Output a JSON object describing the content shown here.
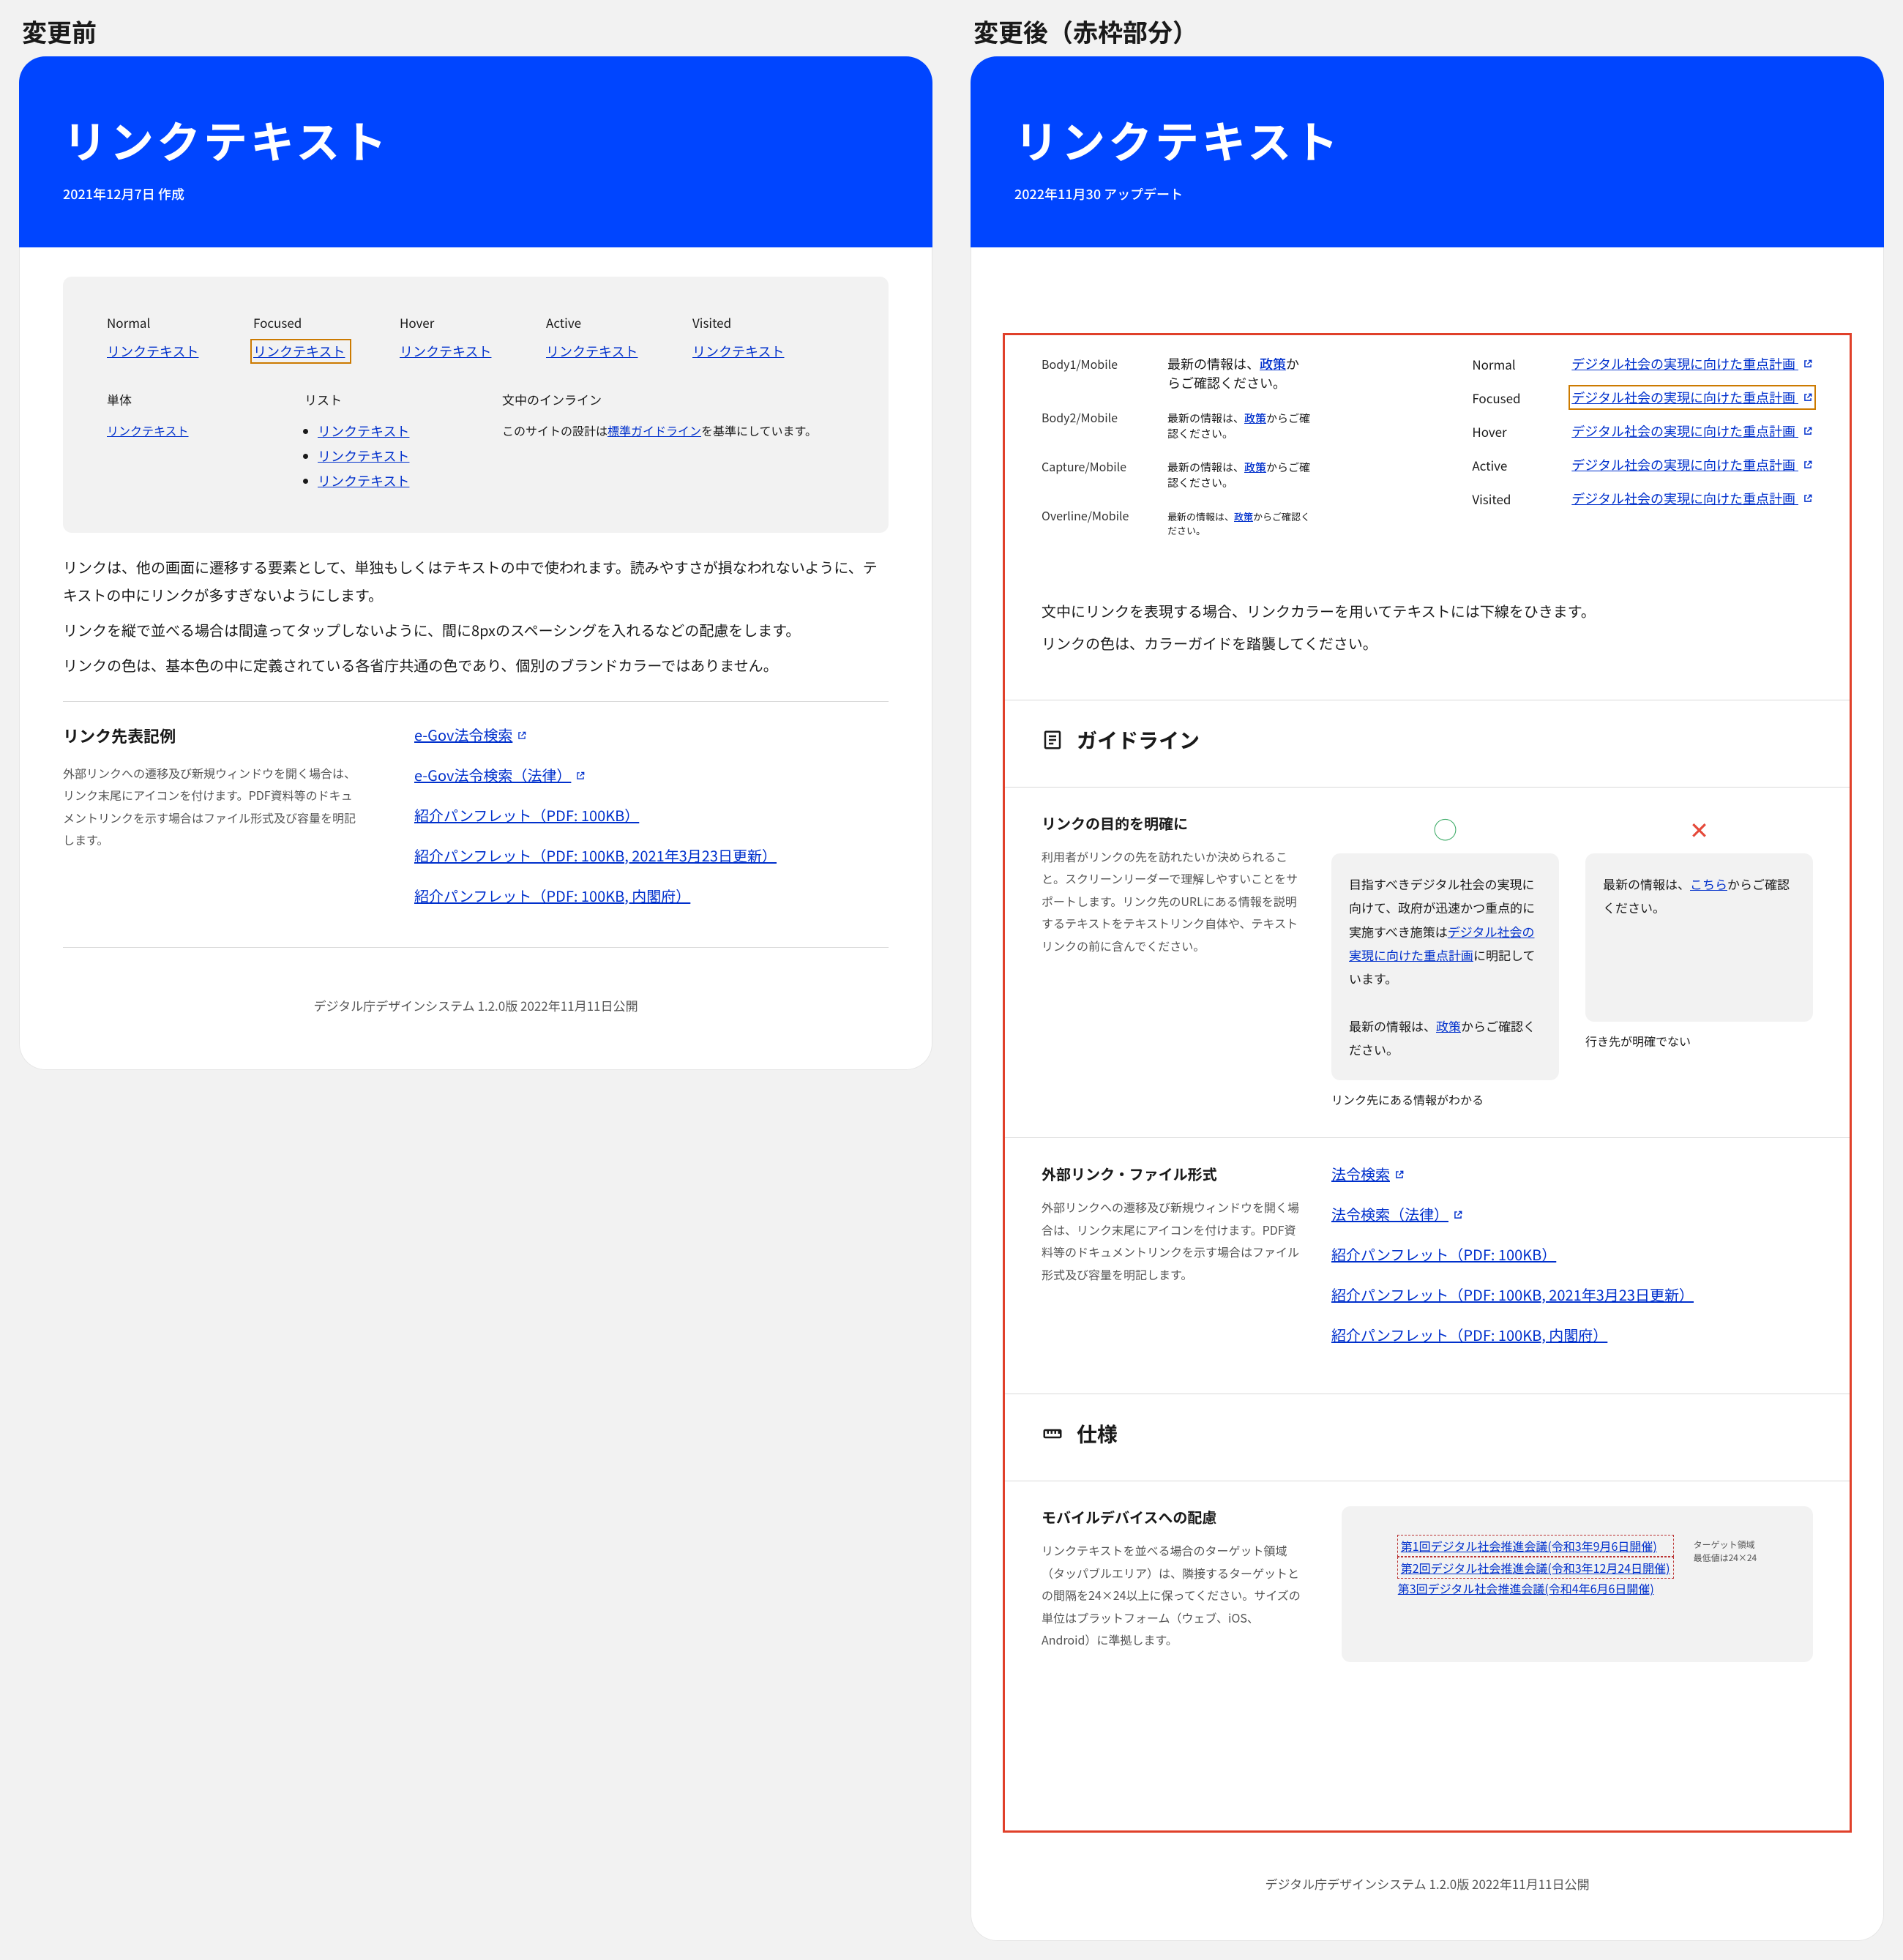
{
  "labels": {
    "before": "変更前",
    "after": "変更後（赤枠部分）"
  },
  "header": {
    "title": "リンクテキスト",
    "date_before": "2021年12月7日 作成",
    "date_after": "2022年11月30 アップデート"
  },
  "left": {
    "state_labels": {
      "normal": "Normal",
      "focused": "Focused",
      "hover": "Hover",
      "active": "Active",
      "visited": "Visited"
    },
    "sample": "リンクテキスト",
    "cols": {
      "single": "単体",
      "list": "リスト",
      "inline": "文中のインライン",
      "inline_sent_prefix": "このサイトの設計は",
      "inline_link": "標準ガイドライン",
      "inline_sent_suffix": "を基準にしています。"
    },
    "lead1": "リンクは、他の画面に遷移する要素として、単独もしくはテキストの中で使われます。読みやすさが損なわれないように、テキストの中にリンクが多すぎないようにします。",
    "lead2": "リンクを縦で並べる場合は間違ってタップしないように、間に8pxのスペーシングを入れるなどの配慮をします。",
    "lead3": "リンクの色は、基本色の中に定義されている各省庁共通の色であり、個別のブランドカラーではありません。",
    "ext_hd": "リンク先表記例",
    "ext_desc": "外部リンクへの遷移及び新規ウィンドウを開く場合は、リンク末尾にアイコンを付けます。PDF資料等のドキュメントリンクを示す場合はファイル形式及び容量を明記します。",
    "ext_links": [
      "e-Gov法令検索",
      "e-Gov法令検索（法律）",
      "紹介パンフレット（PDF: 100KB）",
      "紹介パンフレット（PDF: 100KB, 2021年3月23日更新）",
      "紹介パンフレット（PDF: 100KB, 内閣府）"
    ],
    "footer": "デジタル庁デザインシステム 1.2.0版 2022年11月11日公開"
  },
  "right": {
    "body_sizes": [
      {
        "k": "Body1/Mobile",
        "pre": "最新の情報は、",
        "link": "政策",
        "suf": "からご確認ください。"
      },
      {
        "k": "Body2/Mobile",
        "pre": "最新の情報は、",
        "link": "政策",
        "suf": "からご確認ください。"
      },
      {
        "k": "Capture/Mobile",
        "pre": "最新の情報は、",
        "link": "政策",
        "suf": "からご確認ください。"
      },
      {
        "k": "Overline/Mobile",
        "pre": "最新の情報は、",
        "link": "政策",
        "suf": "からご確認ください。"
      }
    ],
    "link_states": [
      {
        "k": "Normal",
        "t": "デジタル社会の実現に向けた重点計画"
      },
      {
        "k": "Focused",
        "t": "デジタル社会の実現に向けた重点計画"
      },
      {
        "k": "Hover",
        "t": "デジタル社会の実現に向けた重点計画"
      },
      {
        "k": "Active",
        "t": "デジタル社会の実現に向けた重点計画"
      },
      {
        "k": "Visited",
        "t": "デジタル社会の実現に向けた重点計画"
      }
    ],
    "inline_note1": "文中にリンクを表現する場合、リンクカラーを用いてテキストには下線をひきます。",
    "inline_note2": "リンクの色は、カラーガイドを踏襲してください。",
    "guideline_hd": "ガイドライン",
    "purpose": {
      "hd": "リンクの目的を明確に",
      "desc": "利用者がリンクの先を訪れたいか決められること。スクリーンリーダーで理解しやすいことをサポートします。リンク先のURLにある情報を説明するテキストをテキストリンク自体や、テキストリンクの前に含んでください。",
      "good_text_pre": "目指すべきデジタル社会の実現に向けて、政府が迅速かつ重点的に実施すべき施策は",
      "good_link": "デジタル社会の実現に向けた重点計画",
      "good_text_suf": "に明記しています。",
      "good_text2_pre": "最新の情報は、",
      "good_text2_link": "政策",
      "good_text2_suf": "からご確認ください。",
      "bad_pre": "最新の情報は、",
      "bad_link": "こちら",
      "bad_suf": "からご確認ください。",
      "good_cap": "リンク先にある情報がわかる",
      "bad_cap": "行き先が明確でない"
    },
    "ext": {
      "hd": "外部リンク・ファイル形式",
      "desc": "外部リンクへの遷移及び新規ウィンドウを開く場合は、リンク末尾にアイコンを付けます。PDF資料等のドキュメントリンクを示す場合はファイル形式及び容量を明記します。",
      "links": [
        "法令検索",
        "法令検索（法律）",
        "紹介パンフレット（PDF: 100KB）",
        "紹介パンフレット（PDF: 100KB, 2021年3月23日更新）",
        "紹介パンフレット（PDF: 100KB, 内閣府）"
      ]
    },
    "spec_hd": "仕様",
    "mobile": {
      "hd": "モバイルデバイスへの配慮",
      "desc": "リンクテキストを並べる場合のターゲット領域（タッパブルエリア）は、隣接するターゲットとの間隔を24×24以上に保ってください。サイズの単位はプラットフォーム（ウェブ、iOS、Android）に準拠します。",
      "items": [
        "第1回デジタル社会推進会議(令和3年9月6日開催)",
        "第2回デジタル社会推進会議(令和3年12月24日開催)",
        "第3回デジタル社会推進会議(令和4年6月6日開催)"
      ],
      "target_note1": "ターゲット領域",
      "target_note2": "最低値は24×24"
    },
    "footer": "デジタル庁デザインシステム 1.2.0版 2022年11月11日公開"
  }
}
